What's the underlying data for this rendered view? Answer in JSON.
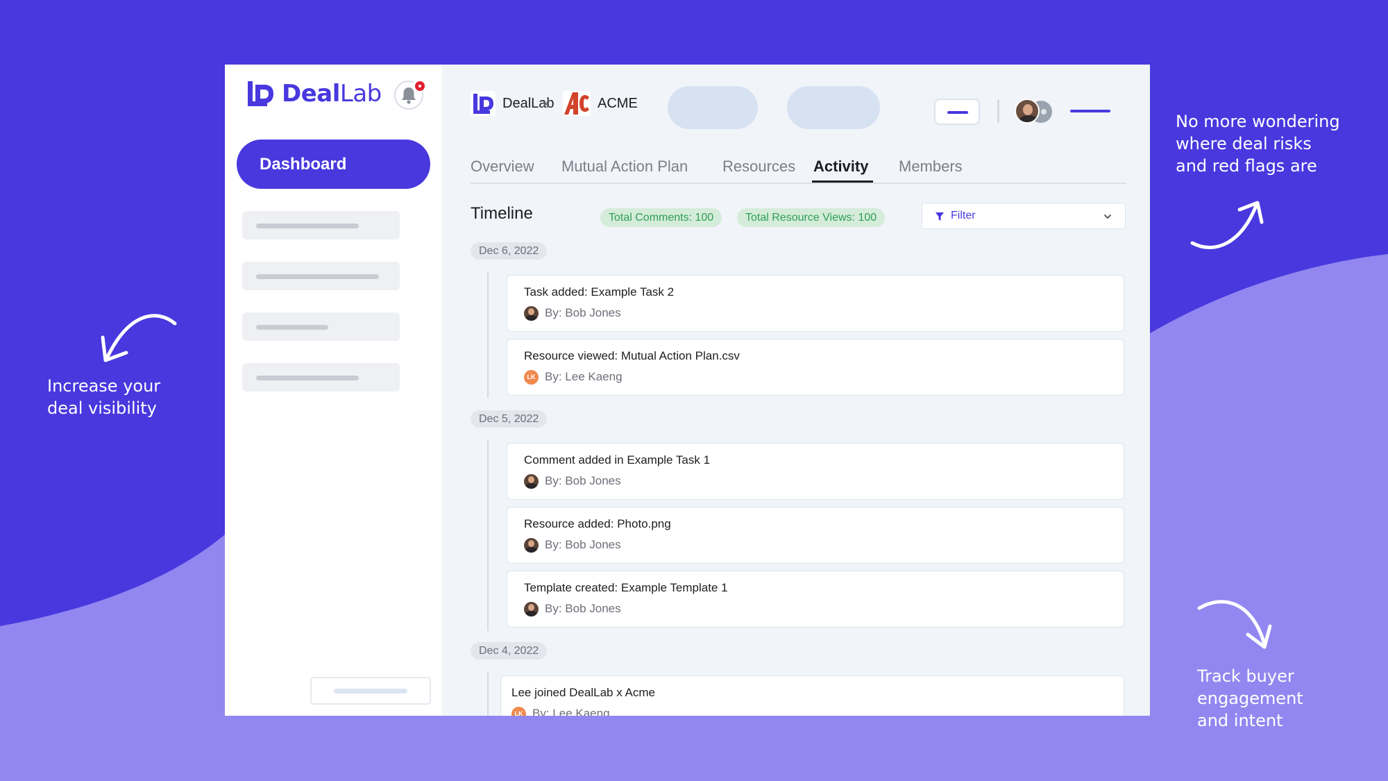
{
  "colors": {
    "brand": "#4838DE",
    "background": "#4838DE",
    "wave": "#9287F0",
    "badge_text": "#2f9e57",
    "badge_bg": "#d4ecd9"
  },
  "callouts": {
    "left": "Increase your\ndeal visibility",
    "top_right": "No more wondering\nwhere deal risks\nand red flags are",
    "bottom_right": "Track buyer\nengagement\nand intent"
  },
  "sidebar": {
    "logo": {
      "bold": "Deal",
      "light": "Lab"
    },
    "notification_icon": "bell-icon",
    "dashboard_label": "Dashboard"
  },
  "header": {
    "company_a": "DealLab",
    "separator": "×",
    "company_b": "ACME"
  },
  "tabs": [
    {
      "label": "Overview",
      "active": false
    },
    {
      "label": "Mutual Action Plan",
      "active": false
    },
    {
      "label": "Resources",
      "active": false
    },
    {
      "label": "Activity",
      "active": true
    },
    {
      "label": "Members",
      "active": false
    }
  ],
  "timeline": {
    "title": "Timeline",
    "total_comments": "Total Comments: 100",
    "total_views": "Total Resource Views: 100",
    "filter_label": "Filter",
    "groups": [
      {
        "date": "Dec 6, 2022",
        "items": [
          {
            "title": "Task added: Example Task 2",
            "by": "By: Bob Jones",
            "avatar": "photo"
          },
          {
            "title": "Resource viewed: Mutual Action Plan.csv",
            "by": "By: Lee Kaeng",
            "avatar": "initials",
            "initials": "LK"
          }
        ]
      },
      {
        "date": "Dec 5, 2022",
        "items": [
          {
            "title": "Comment added in Example Task 1",
            "by": "By: Bob Jones",
            "avatar": "photo"
          },
          {
            "title": "Resource added: Photo.png",
            "by": "By: Bob Jones",
            "avatar": "photo"
          },
          {
            "title": "Template created: Example Template 1",
            "by": "By: Bob Jones",
            "avatar": "photo"
          }
        ]
      },
      {
        "date": "Dec 4, 2022",
        "items": [
          {
            "title": "Lee joined DealLab x Acme",
            "by": "By: Lee Kaeng",
            "avatar": "initials",
            "initials": "LK"
          }
        ]
      }
    ]
  }
}
